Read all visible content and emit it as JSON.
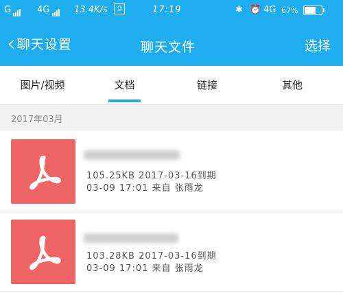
{
  "status_bar": {
    "carrier1": "G",
    "carrier2": "4G",
    "speed": "13.4K/s",
    "time": "17:19",
    "network": "4G",
    "battery_text": "67%",
    "battery_level": 0.67
  },
  "nav": {
    "back_label": "聊天设置",
    "title": "聊天文件",
    "action_label": "选择"
  },
  "tabs": [
    {
      "label": "图片/视频"
    },
    {
      "label": "文档",
      "active": true
    },
    {
      "label": "链接"
    },
    {
      "label": "其他"
    }
  ],
  "section_header": "2017年03月",
  "files": [
    {
      "size_expiry": "105.25KB  2017-03-16到期",
      "date_sender": "03-09 17:01  来自 张雨龙"
    },
    {
      "size_expiry": "103.28KB  2017-03-16到期",
      "date_sender": "03-09 17:01  来自 张雨龙"
    }
  ],
  "colors": {
    "accent": "#1eaef0",
    "pdf_bg": "#ef6464"
  }
}
